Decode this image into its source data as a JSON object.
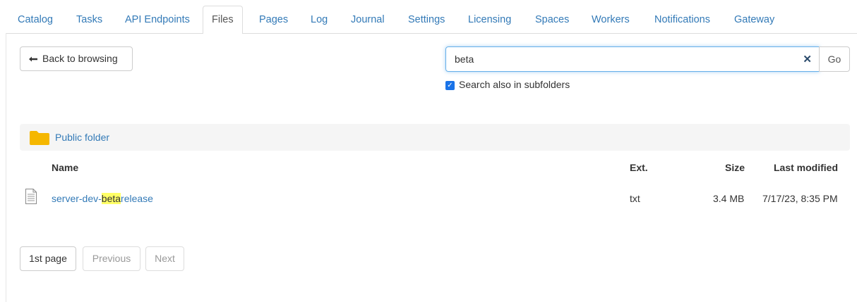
{
  "tabs": [
    {
      "label": "Catalog",
      "active": false
    },
    {
      "label": "Tasks",
      "active": false
    },
    {
      "label": "API Endpoints",
      "active": false
    },
    {
      "label": "Files",
      "active": true
    },
    {
      "label": "Pages",
      "active": false
    },
    {
      "label": "Log",
      "active": false
    },
    {
      "label": "Journal",
      "active": false
    },
    {
      "label": "Settings",
      "active": false
    },
    {
      "label": "Licensing",
      "active": false
    },
    {
      "label": "Spaces",
      "active": false
    },
    {
      "label": "Workers",
      "active": false
    },
    {
      "label": "Notifications",
      "active": false
    },
    {
      "label": "Gateway",
      "active": false
    }
  ],
  "toolbar": {
    "back_icon": "arrow-left-icon",
    "back_label": "Back to browsing",
    "search_value": "beta",
    "clear_icon": "close-icon",
    "go_label": "Go",
    "subfolders_checked": true,
    "subfolders_label": "Search also in subfolders"
  },
  "folder": {
    "icon": "folder-icon",
    "label": "Public folder"
  },
  "table": {
    "headers": {
      "name": "Name",
      "ext": "Ext.",
      "size": "Size",
      "modified": "Last modified"
    },
    "rows": [
      {
        "icon": "text-file-icon",
        "name_prefix": "server-dev-",
        "name_match": "beta",
        "name_suffix": "release",
        "ext": "txt",
        "size": "3.4 MB",
        "modified": "7/17/23, 8:35 PM"
      }
    ]
  },
  "pagination": {
    "first_label": "1st page",
    "previous_label": "Previous",
    "next_label": "Next"
  },
  "colors": {
    "link": "#337ab7",
    "highlight": "#ffff66",
    "folder": "#f5b700",
    "checkbox": "#1a73e8"
  }
}
